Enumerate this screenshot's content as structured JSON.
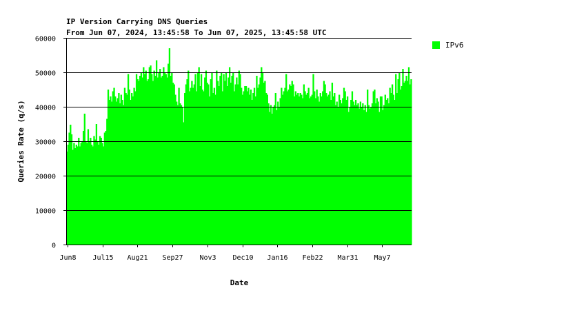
{
  "chart_data": {
    "type": "bar",
    "title": "IP Version Carrying DNS Queries",
    "subtitle": "From Jun 07, 2024, 13:45:58 To Jun 07, 2025, 13:45:58 UTC",
    "xlabel": "Date",
    "ylabel": "Queries Rate (q/s)",
    "ylim": [
      0,
      60000
    ],
    "yticks": [
      0,
      10000,
      20000,
      30000,
      40000,
      50000,
      60000
    ],
    "xticks": [
      "Jun8",
      "Jul15",
      "Aug21",
      "Sep27",
      "Nov3",
      "Dec10",
      "Jan16",
      "Feb22",
      "Mar31",
      "May7"
    ],
    "grid": "horizontal",
    "legend_position": "right",
    "series": [
      {
        "name": "IPv6",
        "color": "#00ff00",
        "values": [
          27000,
          29000,
          32500,
          34800,
          32000,
          27500,
          29500,
          28000,
          29000,
          28500,
          31000,
          28500,
          29500,
          30000,
          33000,
          38000,
          30000,
          29500,
          33500,
          30000,
          31000,
          29000,
          28500,
          31500,
          30500,
          35000,
          30000,
          29000,
          31500,
          31000,
          29500,
          28500,
          32500,
          33000,
          36500,
          45000,
          42000,
          43000,
          41500,
          44500,
          45500,
          43000,
          41500,
          42500,
          44000,
          41000,
          43500,
          42000,
          40500,
          45500,
          44000,
          43500,
          49500,
          45000,
          42000,
          44000,
          43000,
          45500,
          44500,
          49500,
          48000,
          47500,
          49000,
          50000,
          48500,
          51500,
          49500,
          50500,
          47500,
          48000,
          51500,
          52000,
          49500,
          47500,
          50500,
          49000,
          53500,
          48500,
          50000,
          51000,
          48500,
          49000,
          51500,
          50000,
          49500,
          48500,
          52500,
          57000,
          49000,
          50000,
          47000,
          46500,
          43500,
          41500,
          40500,
          45500,
          41000,
          40500,
          40000,
          35500,
          44000,
          46500,
          48000,
          50500,
          44500,
          45500,
          47500,
          45500,
          46500,
          49500,
          44500,
          50000,
          51500,
          46000,
          49500,
          45000,
          44500,
          48500,
          50500,
          47000,
          46500,
          43000,
          48000,
          50000,
          44000,
          45500,
          43500,
          50500,
          47500,
          46000,
          49000,
          50000,
          44500,
          49500,
          47500,
          50000,
          46000,
          48500,
          51500,
          47000,
          49000,
          50000,
          44500,
          46500,
          48500,
          46500,
          50500,
          49500,
          45500,
          43500,
          44500,
          46000,
          46000,
          44500,
          45500,
          43500,
          45000,
          42000,
          44000,
          45500,
          43000,
          49000,
          45500,
          46500,
          48500,
          51500,
          50000,
          47000,
          47500,
          44000,
          43500,
          41000,
          38500,
          40500,
          38000,
          40000,
          40500,
          44000,
          39000,
          41500,
          40000,
          42500,
          45500,
          43500,
          44500,
          45500,
          49500,
          44500,
          45000,
          46500,
          46000,
          47500,
          46500,
          43000,
          44500,
          43500,
          44000,
          43000,
          44000,
          43500,
          42500,
          46500,
          44500,
          43500,
          44000,
          45500,
          42500,
          43000,
          43500,
          49500,
          44500,
          42500,
          45000,
          43000,
          41500,
          44000,
          43000,
          44500,
          47500,
          46500,
          44000,
          43000,
          43500,
          44500,
          42000,
          47000,
          43000,
          44000,
          40500,
          41500,
          40000,
          43500,
          42000,
          41000,
          42500,
          45500,
          44500,
          42000,
          43000,
          38500,
          40000,
          42000,
          44500,
          41500,
          40500,
          42000,
          40500,
          41000,
          39500,
          41500,
          40000,
          41000,
          39000,
          40500,
          38500,
          45000,
          40500,
          39500,
          40000,
          41000,
          44500,
          45000,
          41000,
          42500,
          41500,
          38500,
          43000,
          43000,
          39000,
          40500,
          43500,
          42000,
          42500,
          41000,
          45500,
          44000,
          46500,
          43500,
          42000,
          49500,
          44000,
          48000,
          50000,
          45000,
          46000,
          51000,
          47000,
          47500,
          49000,
          47500,
          51500,
          46500,
          48000
        ]
      }
    ]
  }
}
